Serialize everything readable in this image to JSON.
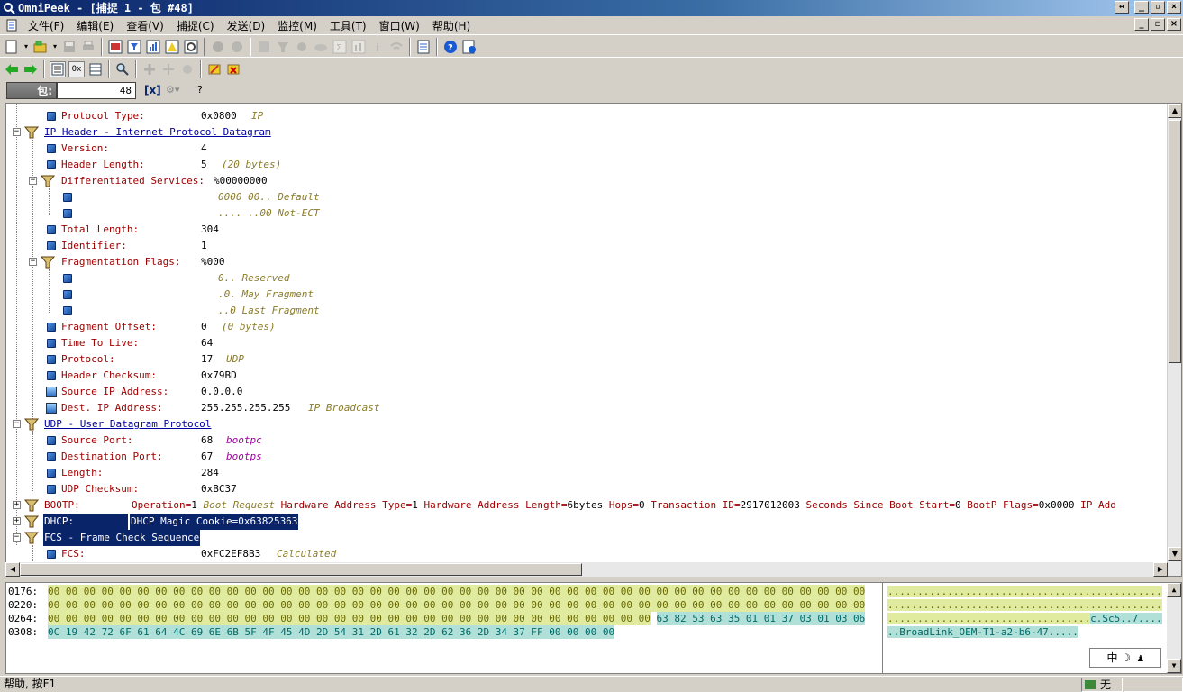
{
  "window": {
    "title": "OmniPeek - [捕捉 1 - 包 #48]"
  },
  "menu": [
    "文件(F)",
    "编辑(E)",
    "查看(V)",
    "捕捉(C)",
    "发送(D)",
    "监控(M)",
    "工具(T)",
    "窗口(W)",
    "帮助(H)"
  ],
  "packet": {
    "label": "包:",
    "number": "48",
    "clear_label": "[x]",
    "help_label": "?"
  },
  "decode": {
    "protocol_type": {
      "label": "Protocol Type:",
      "value": "0x0800",
      "note": "IP"
    },
    "ip_header": "IP Header - Internet Protocol Datagram",
    "version": {
      "label": "Version:",
      "value": "4"
    },
    "header_length": {
      "label": "Header Length:",
      "value": "5",
      "note": "(20 bytes)"
    },
    "diff_services": {
      "label": "Differentiated Services:",
      "value": "%00000000"
    },
    "ds_default": "0000 00.. Default",
    "ds_not_ect": ".... ..00 Not-ECT",
    "total_length": {
      "label": "Total Length:",
      "value": "304"
    },
    "identifier": {
      "label": "Identifier:",
      "value": "1"
    },
    "frag_flags": {
      "label": "Fragmentation Flags:",
      "value": "%000"
    },
    "ff_reserved": "0.. Reserved",
    "ff_may": ".0. May Fragment",
    "ff_last": "..0 Last Fragment",
    "frag_offset": {
      "label": "Fragment Offset:",
      "value": "0",
      "note": "(0 bytes)"
    },
    "ttl": {
      "label": "Time To Live:",
      "value": "64"
    },
    "protocol": {
      "label": "Protocol:",
      "value": "17",
      "note": "UDP"
    },
    "checksum": {
      "label": "Header Checksum:",
      "value": "0x79BD"
    },
    "src_ip": {
      "label": "Source IP Address:",
      "value": "0.0.0.0"
    },
    "dst_ip": {
      "label": "Dest. IP Address:",
      "value": "255.255.255.255",
      "note": "IP Broadcast"
    },
    "udp_header": "UDP - User Datagram Protocol",
    "src_port": {
      "label": "Source Port:",
      "value": "68",
      "note": "bootpc"
    },
    "dst_port": {
      "label": "Destination Port:",
      "value": "67",
      "note": "bootps"
    },
    "udp_length": {
      "label": "Length:",
      "value": "284"
    },
    "udp_checksum": {
      "label": "UDP Checksum:",
      "value": "0xBC37"
    },
    "bootp": {
      "label": "BOOTP:",
      "op_label": "Operation=",
      "op_value": "1",
      "op_note": "Boot Request",
      "rest": [
        {
          "k": "Hardware Address Type=",
          "v": "1"
        },
        {
          "k": "Hardware Address Length=",
          "v": "6bytes"
        },
        {
          "k": "Hops=",
          "v": "0"
        },
        {
          "k": "Transaction ID=",
          "v": "2917012003"
        },
        {
          "k": "Seconds Since Boot Start=",
          "v": "0"
        },
        {
          "k": "BootP Flags=",
          "v": "0x0000"
        },
        {
          "k": "IP Add",
          "v": ""
        }
      ]
    },
    "dhcp": {
      "label": "DHCP:",
      "value": "DHCP Magic Cookie=0x63825363"
    },
    "fcs_header": "FCS - Frame Check Sequence",
    "fcs": {
      "label": "FCS:",
      "value": "0xFC2EF8B3",
      "note": "Calculated"
    }
  },
  "hex": {
    "rows": [
      {
        "offset": "0176:",
        "bytes_y": "00 00 00 00 00 00 00 00 00 00 00 00 00 00 00 00 00 00 00 00 00 00 00 00 00 00 00 00 00 00 00 00 00 00 00 00 00 00 00 00 00 00 00 00 00 00",
        "bytes_c": "",
        "ascii_y": "..............................................",
        "ascii_c": ""
      },
      {
        "offset": "0220:",
        "bytes_y": "00 00 00 00 00 00 00 00 00 00 00 00 00 00 00 00 00 00 00 00 00 00 00 00 00 00 00 00 00 00 00 00 00 00 00 00 00 00 00 00 00 00 00 00 00 00",
        "bytes_c": "",
        "ascii_y": "..............................................",
        "ascii_c": ""
      },
      {
        "offset": "0264:",
        "bytes_y": "00 00 00 00 00 00 00 00 00 00 00 00 00 00 00 00 00 00 00 00 00 00 00 00 00 00 00 00 00 00 00 00 00 00",
        "bytes_c": "63 82 53 63 35 01 01 37 03 01 03 06",
        "ascii_y": "..................................",
        "ascii_c": "c.Sc5..7...."
      },
      {
        "offset": "0308:",
        "bytes_y": "",
        "bytes_c": "0C 19 42 72 6F 61 64 4C 69 6E 6B 5F 4F 45 4D 2D 54 31 2D 61 32 2D 62 36 2D 34 37 FF 00 00 00 00",
        "ascii_y": "",
        "ascii_c": "..BroadLink_OEM-T1-a2-b6-47....."
      }
    ]
  },
  "ime": {
    "text": "中 ☽ ♟"
  },
  "status": {
    "left": "帮助, 按F1",
    "right": "无"
  }
}
